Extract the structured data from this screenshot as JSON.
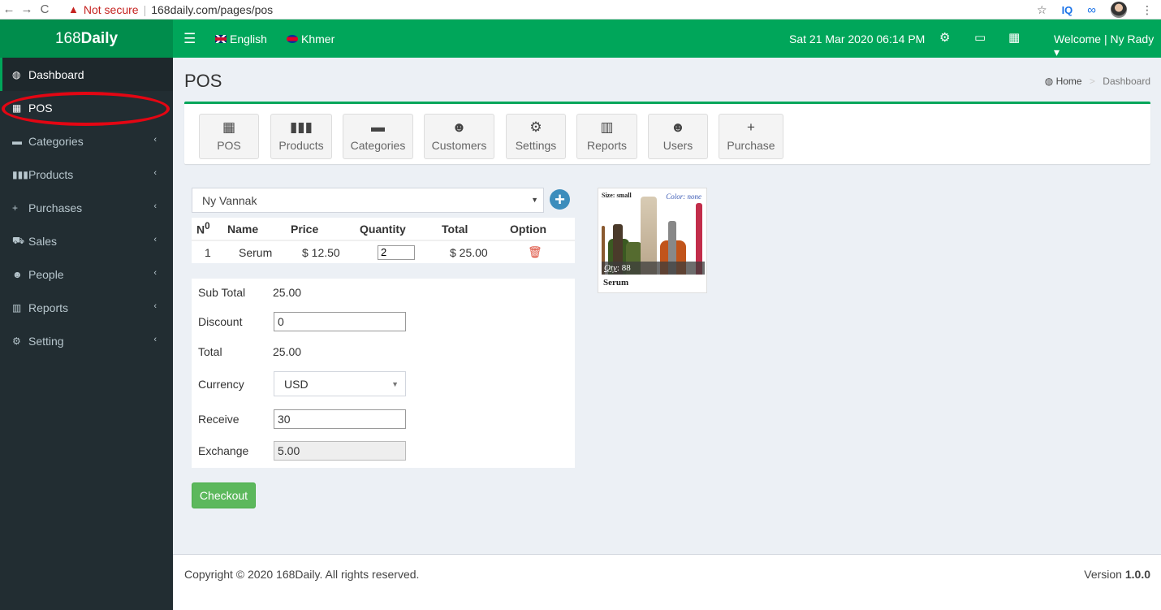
{
  "browser": {
    "back": "←",
    "forward": "→",
    "reload": "C",
    "warning_icon": "▲",
    "security": "Not secure",
    "separator": "|",
    "url": "168daily.com/pages/pos",
    "star": "☆",
    "ext1": "IQ",
    "ext2": "∞",
    "menu": "⋮"
  },
  "header": {
    "brand_light": "168",
    "brand_bold": "Daily",
    "menu_icon": "☰",
    "lang_en": "English",
    "lang_kh": "Khmer",
    "datetime": "Sat 21 Mar 2020 06:14 PM",
    "settings_icon": "⚙",
    "monitor_icon": "▭",
    "grid_icon": "▦",
    "welcome": "Welcome | Ny Rady ▾"
  },
  "sidebar": {
    "items": [
      {
        "label": "Dashboard",
        "icon": "◍"
      },
      {
        "label": "POS",
        "icon": "▦"
      },
      {
        "label": "Categories",
        "icon": "▬",
        "chevron": "‹"
      },
      {
        "label": "Products",
        "icon": "▮▮▮",
        "chevron": "‹"
      },
      {
        "label": "Purchases",
        "icon": "+",
        "chevron": "‹"
      },
      {
        "label": "Sales",
        "icon": "⛟",
        "chevron": "‹"
      },
      {
        "label": "People",
        "icon": "☻",
        "chevron": "‹"
      },
      {
        "label": "Reports",
        "icon": "▥",
        "chevron": "‹"
      },
      {
        "label": "Setting",
        "icon": "⚙",
        "chevron": "‹"
      }
    ]
  },
  "content": {
    "title": "POS",
    "breadcrumb_icon": "◍",
    "breadcrumb_home": "Home",
    "breadcrumb_sep": ">",
    "breadcrumb_current": "Dashboard"
  },
  "shortcuts": [
    {
      "label": "POS",
      "icon": "▦"
    },
    {
      "label": "Products",
      "icon": "▮▮▮"
    },
    {
      "label": "Categories",
      "icon": "▬"
    },
    {
      "label": "Customers",
      "icon": "☻"
    },
    {
      "label": "Settings",
      "icon": "⚙"
    },
    {
      "label": "Reports",
      "icon": "▥"
    },
    {
      "label": "Users",
      "icon": "☻"
    },
    {
      "label": "Purchase",
      "icon": "+"
    }
  ],
  "pos": {
    "customer": "Ny Vannak",
    "caret": "▼",
    "add_icon": "+",
    "columns": {
      "no": "N",
      "no_sup": "0",
      "name": "Name",
      "price": "Price",
      "quantity": "Quantity",
      "total": "Total",
      "option": "Option"
    },
    "rows": [
      {
        "no": "1",
        "name": "Serum",
        "price": "$ 12.50",
        "quantity": "2",
        "total": "$ 25.00",
        "delete_icon": "🗑"
      }
    ],
    "labels": {
      "subtotal": "Sub Total",
      "discount": "Discount",
      "total": "Total",
      "currency": "Currency",
      "receive": "Receive",
      "exchange": "Exchange"
    },
    "values": {
      "subtotal": "25.00",
      "discount": "0",
      "total": "25.00",
      "currency": "USD",
      "receive": "30",
      "exchange": "5.00"
    },
    "checkout": "Checkout"
  },
  "product": {
    "size": "Size: small",
    "color": "Color: none",
    "qty_label": "Qty",
    "qty_value": ": 88",
    "name": "Serum"
  },
  "footer": {
    "copyright": "Copyright © 2020 168Daily. All rights reserved.",
    "version_label": "Version",
    "version_value": "1.0.0"
  },
  "colors": {
    "header_green": "#00a65a",
    "logo_green": "#008d4c",
    "sidebar_dark": "#222d32",
    "checkout_green": "#5cb85c",
    "add_blue": "#3c8dbc",
    "highlight_red": "#e30613"
  }
}
